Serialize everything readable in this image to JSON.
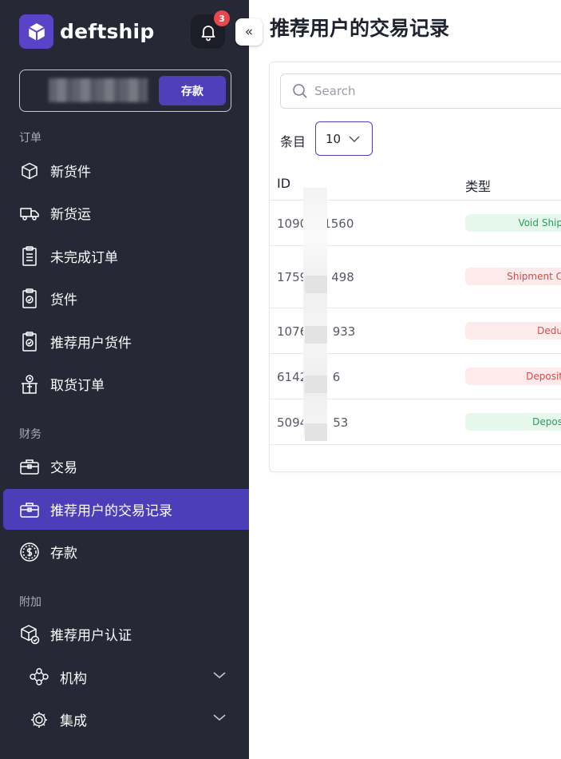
{
  "brand": {
    "name": "deftship",
    "accent": "#4f3fb8",
    "sidebar_bg": "#262836"
  },
  "header": {
    "notification_count": "3",
    "collapse_glyph": "«"
  },
  "balance": {
    "deposit_label": "存款"
  },
  "sidebar": {
    "sections": [
      {
        "label": "订单",
        "items": [
          {
            "label": "新货件",
            "icon": "box-icon"
          },
          {
            "label": "新货运",
            "icon": "truck-icon"
          },
          {
            "label": "未完成订单",
            "icon": "clipboard-list-icon"
          },
          {
            "label": "货件",
            "icon": "clipboard-check-icon"
          },
          {
            "label": "推荐用户货件",
            "icon": "clipboard-check-icon"
          },
          {
            "label": "取货订单",
            "icon": "pickup-icon"
          }
        ]
      },
      {
        "label": "财务",
        "items": [
          {
            "label": "交易",
            "icon": "briefcase-icon"
          },
          {
            "label": "推荐用户的交易记录",
            "icon": "briefcase-icon",
            "active": true
          },
          {
            "label": "存款",
            "icon": "dollar-coin-icon"
          }
        ]
      },
      {
        "label": "附加",
        "items": [
          {
            "label": "推荐用户认证",
            "icon": "verified-box-icon"
          },
          {
            "label": "机构",
            "icon": "organization-icon",
            "expandable": true
          },
          {
            "label": "集成",
            "icon": "integration-gear-icon",
            "expandable": true
          }
        ]
      }
    ]
  },
  "main": {
    "title": "推荐用户的交易记录",
    "search": {
      "placeholder": "Search"
    },
    "entries": {
      "label": "条目",
      "value": "10"
    },
    "table": {
      "columns": [
        "ID",
        "类型"
      ],
      "rows": [
        {
          "id": "1090",
          "id_tail": "1560",
          "type": "Void Ship",
          "status": "green"
        },
        {
          "id": "1759",
          "id_tail": "498",
          "type": "Shipment C",
          "status": "red"
        },
        {
          "id": "10768",
          "id_tail": "933",
          "type": "Dedu",
          "status": "red"
        },
        {
          "id": "61421",
          "id_tail": "6",
          "type": "Deposit",
          "status": "red"
        },
        {
          "id": "5094",
          "id_tail": "53",
          "type": "Depos",
          "status": "green"
        }
      ]
    }
  }
}
